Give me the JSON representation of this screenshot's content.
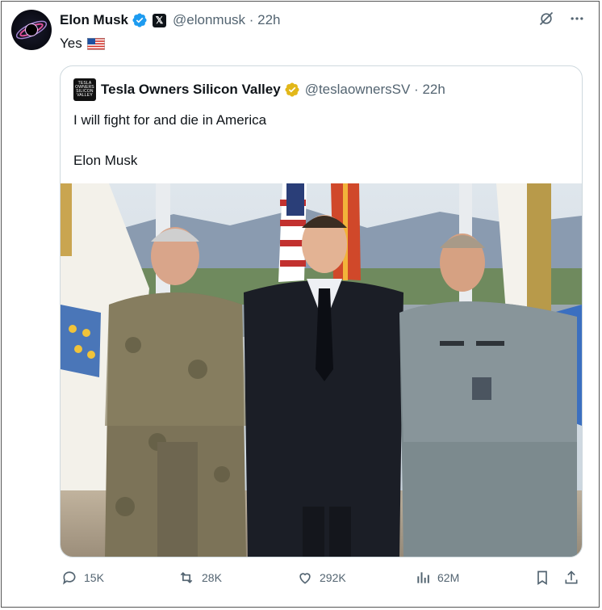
{
  "tweet": {
    "author_name": "Elon Musk",
    "handle_time": "@elonmusk · 22h",
    "text": "Yes"
  },
  "quote": {
    "avatar_lines": [
      "TESLA",
      "OWNERS",
      "SILICON",
      "VALLEY"
    ],
    "author_name": "Tesla Owners Silicon Valley",
    "handle_time": "@teslaownersSV · 22h",
    "line1": "I will fight for and die in America",
    "line2": "Elon Musk"
  },
  "actions": {
    "replies": "15K",
    "reposts": "28K",
    "likes": "292K",
    "views": "62M"
  },
  "colors": {
    "verified_blue": "#1d9bf0",
    "verified_gold": "#e2b719",
    "muted_text": "#536471",
    "border": "#cfd9de"
  },
  "icons": {
    "verified": "verified-badge-icon",
    "x_logo": "x-logo-icon",
    "grok": "grok-icon",
    "more": "more-icon",
    "reply": "reply-icon",
    "repost": "repost-icon",
    "like": "heart-icon",
    "views": "views-icon",
    "bookmark": "bookmark-icon",
    "share": "share-icon"
  }
}
